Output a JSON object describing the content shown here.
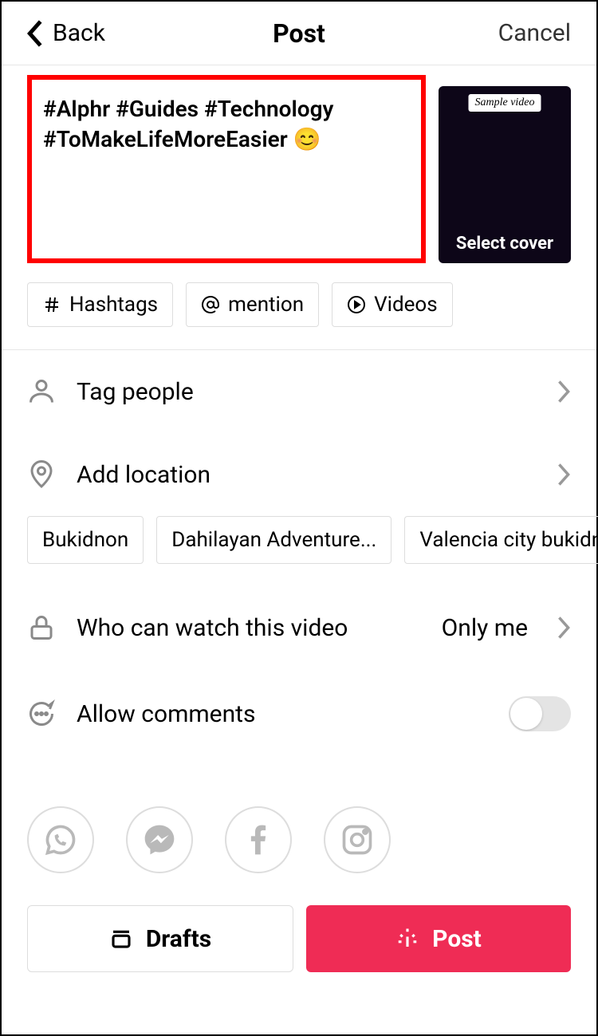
{
  "header": {
    "back": "Back",
    "title": "Post",
    "cancel": "Cancel"
  },
  "caption": "#Alphr #Guides #Technology #ToMakeLifeMoreEasier 😊",
  "thumbnail": {
    "tag": "Sample video",
    "footer": "Select cover"
  },
  "chips": {
    "hashtags": "Hashtags",
    "mention": "mention",
    "videos": "Videos"
  },
  "rows": {
    "tag_people": "Tag people",
    "add_location": "Add location",
    "who_can_watch": "Who can watch this video",
    "who_can_watch_value": "Only me",
    "allow_comments": "Allow comments"
  },
  "location_suggestions": [
    "Bukidnon",
    "Dahilayan Adventure...",
    "Valencia city bukidnon"
  ],
  "allow_comments_on": false,
  "footer": {
    "drafts": "Drafts",
    "post": "Post"
  }
}
